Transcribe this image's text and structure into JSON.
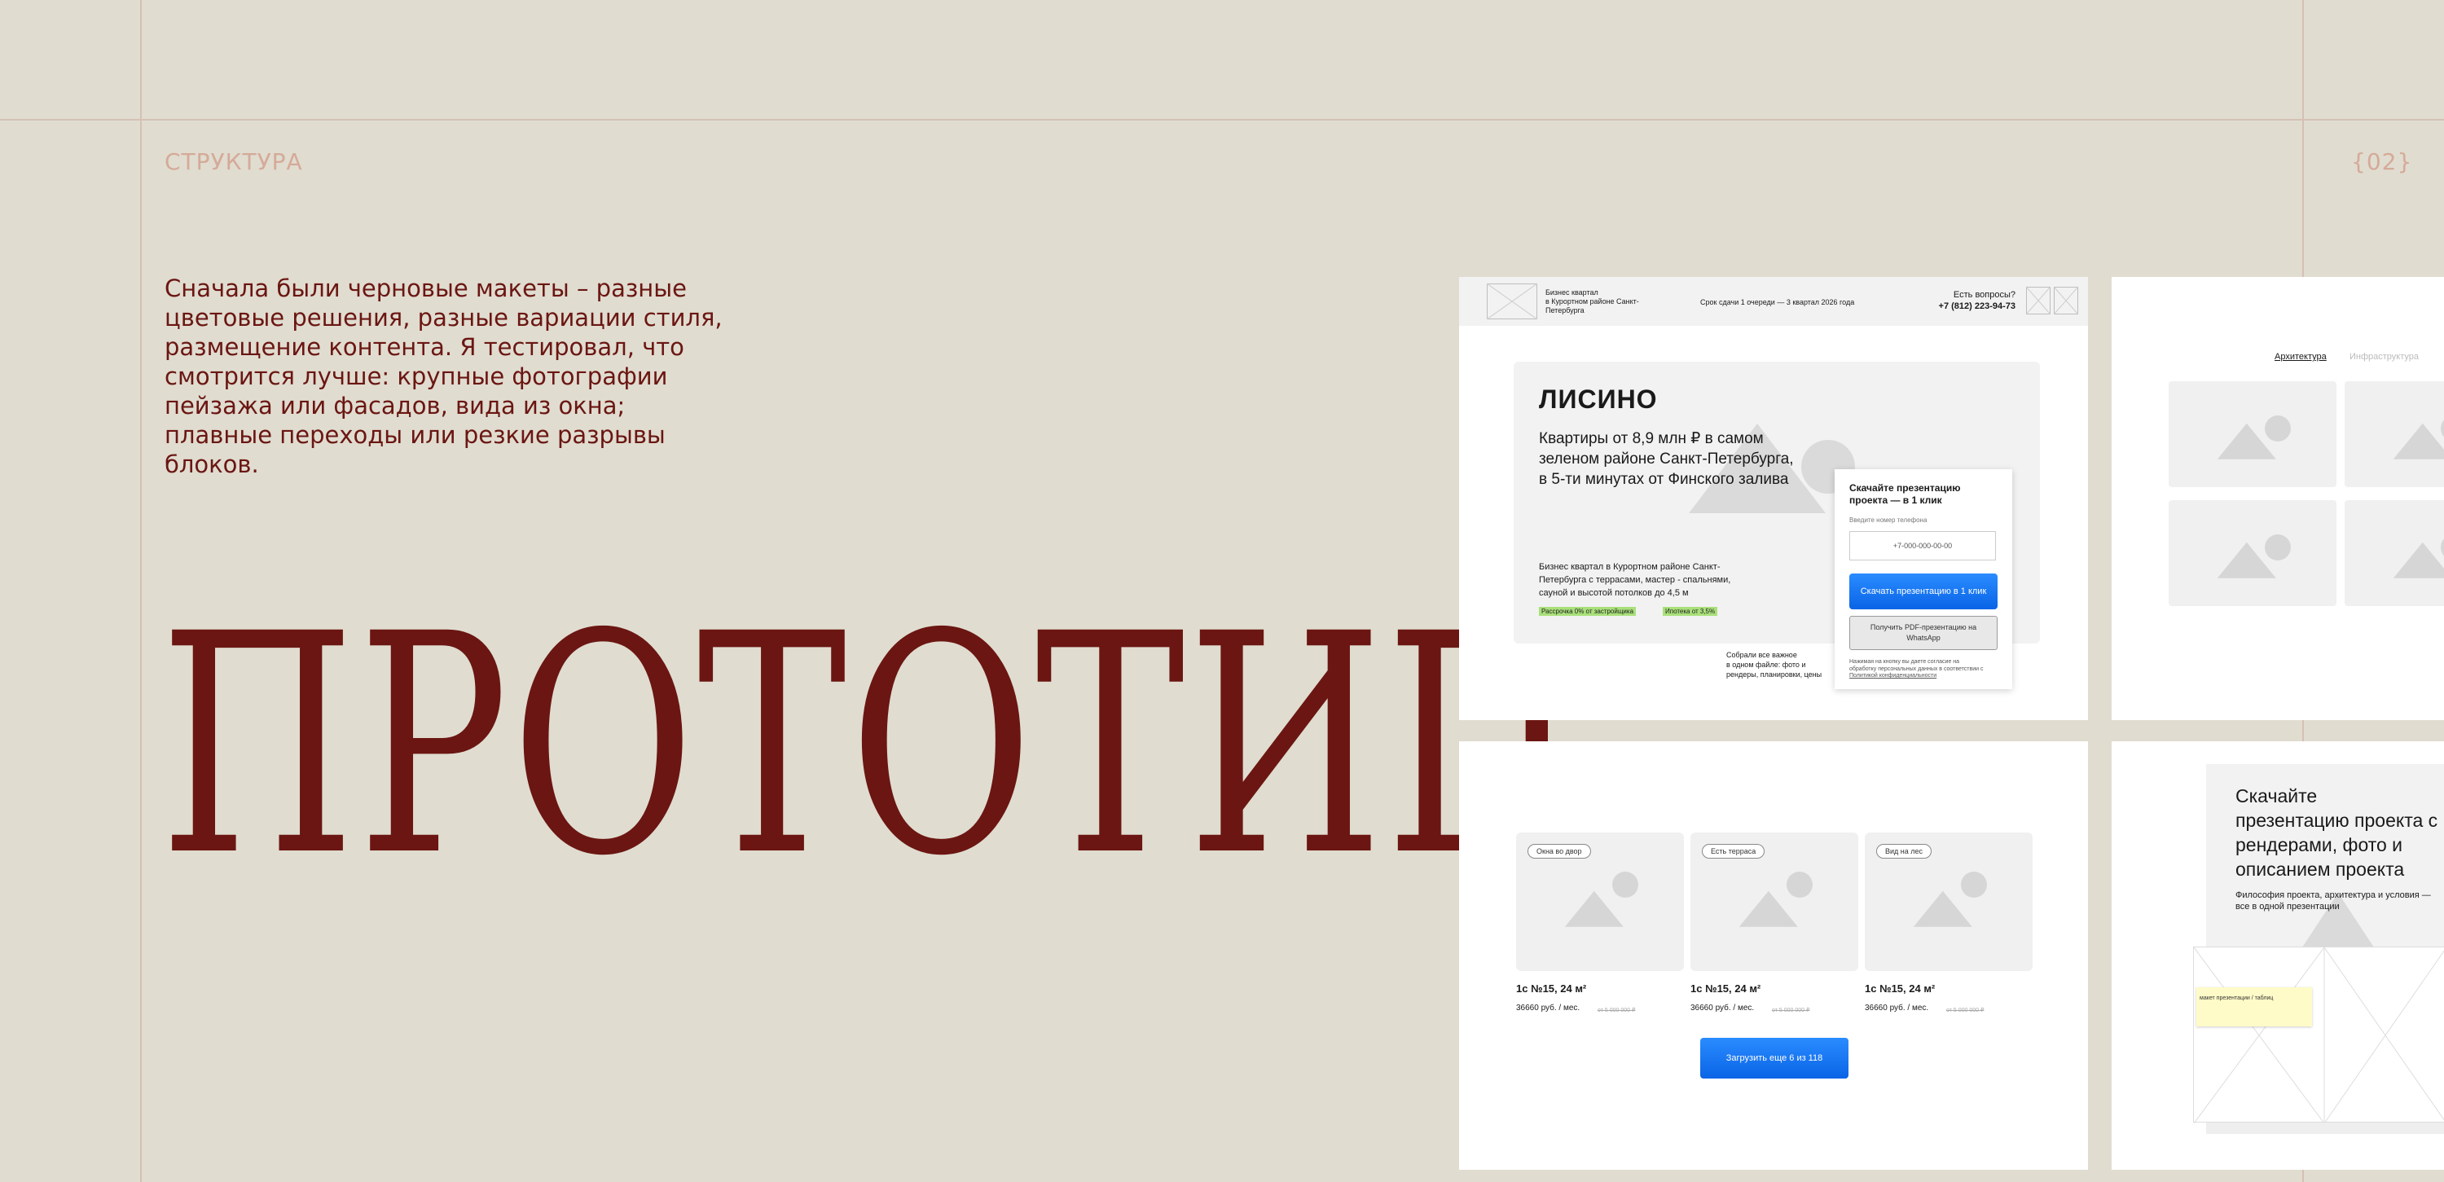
{
  "section": {
    "label": "СТРУКТУРА",
    "number": "{02}"
  },
  "intro_text": "Сначала были черновые макеты – разные цветовые решения, разные вариации стиля, размещение контента. Я тестировал, что смотрится лучше: крупные фотографии пейзажа или фасадов, вида из окна; плавные переходы или резкие разрывы блоков.",
  "title": "ПРОТОТИП",
  "mock1": {
    "header_desc": "Бизнес квартал\nв Курортном районе Санкт-\nПетербурга",
    "deadline": "Срок сдачи 1 очереди — 3 квартал 2026 года",
    "question": "Есть вопросы?",
    "phone": "+7 (812) 223-94-73",
    "hero_title": "ЛИСИНО",
    "hero_sub": "Квартиры от 8,9 млн ₽ в самом\nзеленом районе Санкт-Петербурга,\nв 5-ти минутах от Финского залива",
    "hero_desc": "Бизнес квартал в Курортном районе Санкт-\nПетербурга с террасами, мастер - спальнями,\nсауной и высотой потолков до 4,5 м",
    "badge1": "Рассрочка 0% от застройщика",
    "badge2": "Ипотека от 3,5%",
    "form_title": "Скачайте презентацию\nпроекта — в 1 клик",
    "form_label": "Введите номер телефона",
    "form_placeholder": "+7-000-000-00-00",
    "btn_primary": "Скачать презентацию в 1 клик",
    "btn_secondary": "Получить PDF-презентацию на\nWhatsApp",
    "legal": "Нажимая на кнопку вы даете согласие на\nобработку персональных данных в соответствии с",
    "legal_link": "Политикой конфиденциальности",
    "note": "Собрали все важное\nв одном файле: фото и\nрендеры, планировки, цены"
  },
  "mock2": {
    "nav1": "Архитектура",
    "nav2": "Инфраструктура"
  },
  "mock3": {
    "cards": [
      {
        "tag": "Окна во двор",
        "title": "1с №15, 24 м²",
        "price": "36660 руб. / мес.",
        "old": "от 5 000 000 ₽"
      },
      {
        "tag": "Есть терраса",
        "title": "1с №15, 24 м²",
        "price": "36660 руб. / мес.",
        "old": "от 5 000 000 ₽"
      },
      {
        "tag": "Вид на лес",
        "title": "1с №15, 24 м²",
        "price": "36660 руб. / мес.",
        "old": "от 5 000 000 ₽"
      }
    ],
    "load_more": "Загрузить еще 6 из 118"
  },
  "mock4": {
    "title": "Скачайте\nпрезентацию проекта с\nрендерами, фото и\nописанием проекта",
    "sub": "Философия проекта, архитектура и условия —\nвсе в одной презентации",
    "sticky": "макет презентации / таблиц"
  }
}
